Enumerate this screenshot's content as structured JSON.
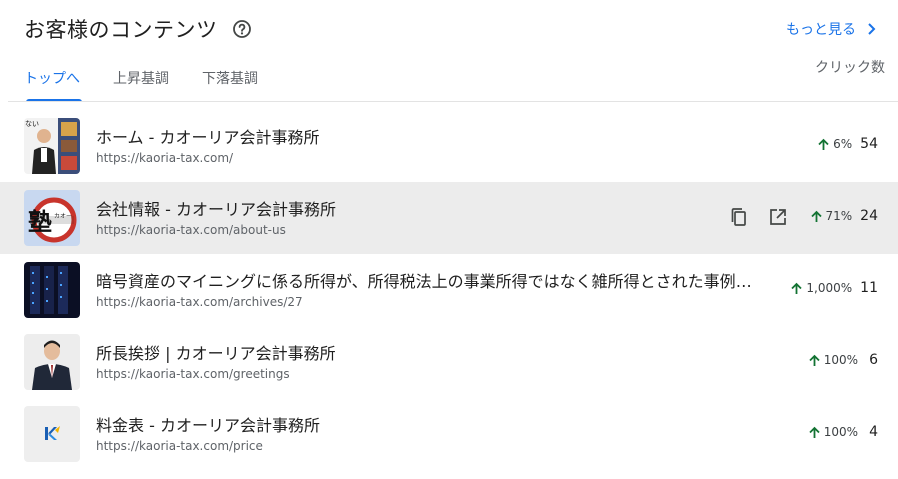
{
  "header": {
    "title": "お客様のコンテンツ",
    "see_more": "もっと見る"
  },
  "tabs": [
    {
      "label": "トップへ",
      "active": true
    },
    {
      "label": "上昇基調",
      "active": false
    },
    {
      "label": "下落基調",
      "active": false
    }
  ],
  "column_header": "クリック数",
  "colors": {
    "accent": "#1a73e8",
    "trend_up": "#137333",
    "hover_row": "#ececec"
  },
  "rows": [
    {
      "title": "ホーム - カオーリア会計事務所",
      "url": "https://kaoria-tax.com/",
      "change": "6%",
      "clicks": "54",
      "thumb": "person-thumbnail"
    },
    {
      "title": "会社情報 - カオーリア会計事務所",
      "url": "https://kaoria-tax.com/about-us",
      "change": "71%",
      "clicks": "24",
      "thumb": "logo-thumbnail",
      "hovered": true
    },
    {
      "title": "暗号資産のマイニングに係る所得が、所得税法上の事業所得ではなく雑所得とされた事例（…",
      "url": "https://kaoria-tax.com/archives/27",
      "change": "1,000%",
      "clicks": "11",
      "thumb": "server-thumbnail"
    },
    {
      "title": "所長挨拶 | カオーリア会計事務所",
      "url": "https://kaoria-tax.com/greetings",
      "change": "100%",
      "clicks": "6",
      "thumb": "portrait-thumbnail"
    },
    {
      "title": "料金表 - カオーリア会計事務所",
      "url": "https://kaoria-tax.com/price",
      "change": "100%",
      "clicks": "4",
      "thumb": "k-logo-thumbnail"
    }
  ]
}
